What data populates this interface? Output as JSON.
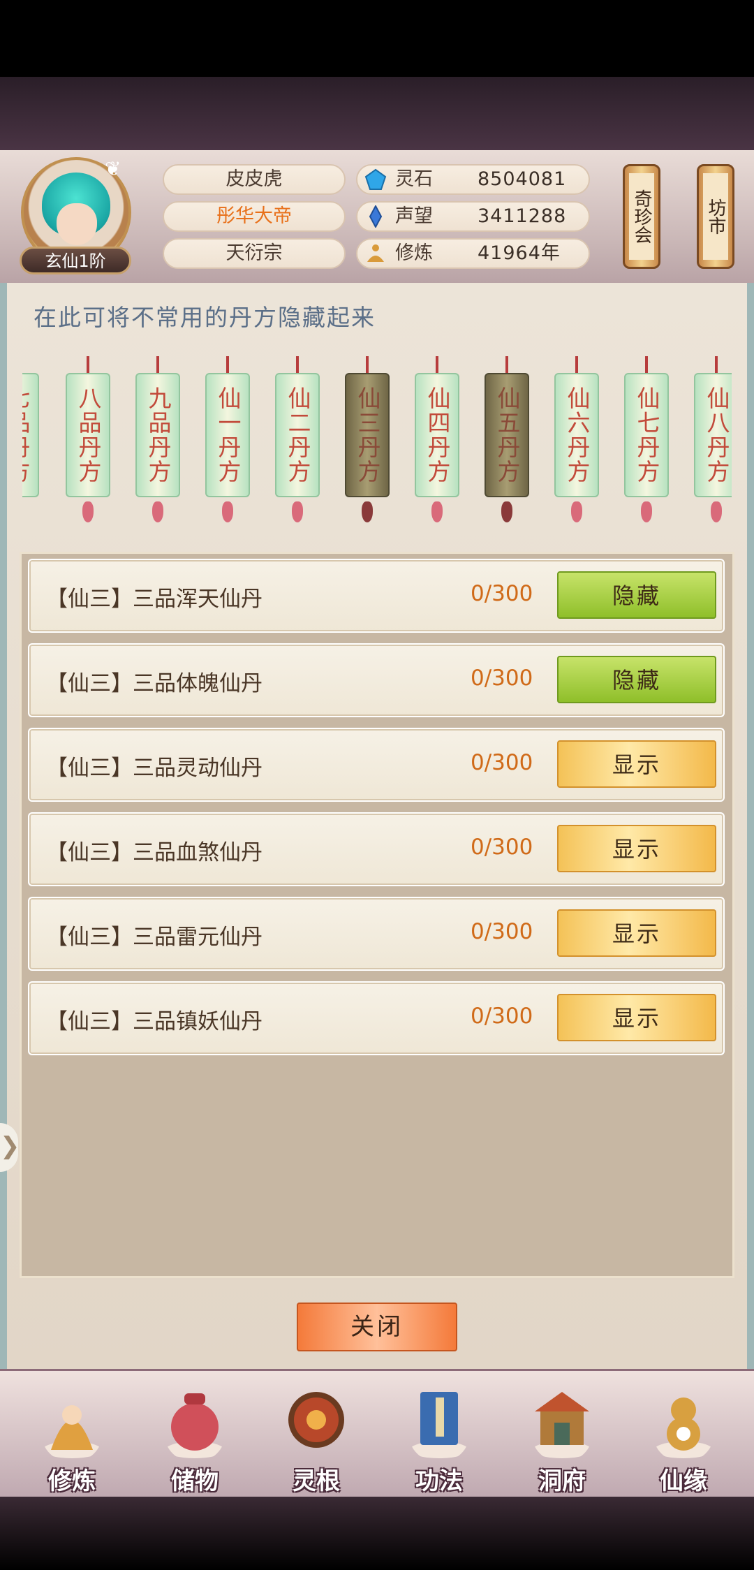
{
  "player": {
    "name": "皮皮虎",
    "title": "彤华大帝",
    "sect": "天衍宗",
    "rank": "玄仙1阶"
  },
  "resources": [
    {
      "label": "灵石",
      "value": "8504081",
      "icon": "spirit-stone-icon",
      "color": "#2fa6e8"
    },
    {
      "label": "声望",
      "value": "3411288",
      "icon": "prestige-crystal-icon",
      "color": "#3a78d8"
    },
    {
      "label": "修炼",
      "value": "41964年",
      "icon": "meditation-icon",
      "color": "#d99a3a"
    }
  ],
  "side_buttons": [
    {
      "label": "奇珍会"
    },
    {
      "label": "坊市"
    }
  ],
  "hint": "在此可将不常用的丹方隐藏起来",
  "tabs": [
    {
      "label": "七品丹方",
      "selected": false
    },
    {
      "label": "八品丹方",
      "selected": false
    },
    {
      "label": "九品丹方",
      "selected": false
    },
    {
      "label": "仙一丹方",
      "selected": false
    },
    {
      "label": "仙二丹方",
      "selected": false
    },
    {
      "label": "仙三丹方",
      "selected": true
    },
    {
      "label": "仙四丹方",
      "selected": false
    },
    {
      "label": "仙五丹方",
      "selected": true
    },
    {
      "label": "仙六丹方",
      "selected": false
    },
    {
      "label": "仙七丹方",
      "selected": false
    },
    {
      "label": "仙八丹方",
      "selected": false
    }
  ],
  "recipes": [
    {
      "name": "【仙三】三品浑天仙丹",
      "count": "0/300",
      "action": "隐藏",
      "state": "hide"
    },
    {
      "name": "【仙三】三品体魄仙丹",
      "count": "0/300",
      "action": "隐藏",
      "state": "hide"
    },
    {
      "name": "【仙三】三品灵动仙丹",
      "count": "0/300",
      "action": "显示",
      "state": "show"
    },
    {
      "name": "【仙三】三品血煞仙丹",
      "count": "0/300",
      "action": "显示",
      "state": "show"
    },
    {
      "name": "【仙三】三品雷元仙丹",
      "count": "0/300",
      "action": "显示",
      "state": "show"
    },
    {
      "name": "【仙三】三品镇妖仙丹",
      "count": "0/300",
      "action": "显示",
      "state": "show"
    }
  ],
  "close_label": "关闭",
  "nav": [
    {
      "label": "修炼",
      "icon": "cultivate-icon",
      "color": "#e0a040"
    },
    {
      "label": "储物",
      "icon": "storage-bag-icon",
      "color": "#d0505a"
    },
    {
      "label": "灵根",
      "icon": "spirit-root-icon",
      "color": "#b8482a"
    },
    {
      "label": "功法",
      "icon": "technique-book-icon",
      "color": "#3a6cb0"
    },
    {
      "label": "洞府",
      "icon": "cave-dwelling-icon",
      "color": "#b07a3a"
    },
    {
      "label": "仙缘",
      "icon": "immortal-fate-icon",
      "color": "#d8a040"
    }
  ]
}
